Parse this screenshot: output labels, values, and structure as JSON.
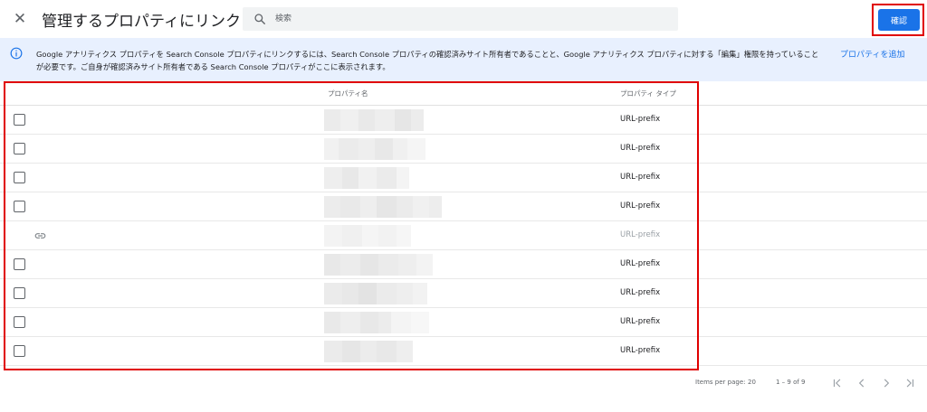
{
  "header": {
    "close_label": "✕",
    "title": "管理するプロパティにリンク",
    "search_placeholder": "検索",
    "confirm_label": "確認"
  },
  "info_banner": {
    "text": "Google アナリティクス プロパティを Search Console プロパティにリンクするには、Search Console プロパティの確認済みサイト所有者であることと、Google アナリティクス プロパティに対する「編集」権限を持っていることが必要です。ご自身が確認済みサイト所有者である Search Console プロパティがここに表示されます。",
    "add_property_link": "プロパティを追加"
  },
  "table": {
    "columns": {
      "name": "プロパティ名",
      "type": "プロパティ タイプ"
    },
    "rows": [
      {
        "selectable": true,
        "linked": false,
        "type": "URL-prefix"
      },
      {
        "selectable": true,
        "linked": false,
        "type": "URL-prefix"
      },
      {
        "selectable": true,
        "linked": false,
        "type": "URL-prefix"
      },
      {
        "selectable": true,
        "linked": false,
        "type": "URL-prefix"
      },
      {
        "selectable": false,
        "linked": true,
        "type": "URL-prefix"
      },
      {
        "selectable": true,
        "linked": false,
        "type": "URL-prefix"
      },
      {
        "selectable": true,
        "linked": false,
        "type": "URL-prefix"
      },
      {
        "selectable": true,
        "linked": false,
        "type": "URL-prefix"
      },
      {
        "selectable": true,
        "linked": false,
        "type": "URL-prefix"
      }
    ]
  },
  "pagination": {
    "items_per_page_label": "Items per page:",
    "items_per_page_value": "20",
    "range_text": "1 – 9 of 9"
  },
  "colors": {
    "accent": "#1a73e8",
    "highlight": "#e00000",
    "banner_bg": "#e8f0fe"
  }
}
